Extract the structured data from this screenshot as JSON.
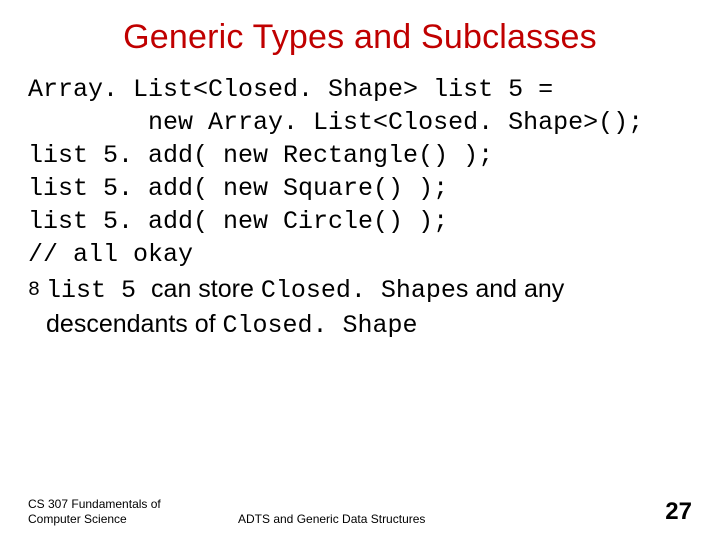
{
  "title": "Generic Types and Subclasses",
  "code": {
    "l1": "Array. List<Closed. Shape> list 5 =",
    "l2": "        new Array. List<Closed. Shape>();",
    "l3": "list 5. add( new Rectangle() );",
    "l4": "list 5. add( new Square() );",
    "l5": "list 5. add( new Circle() );",
    "l6": "// all okay"
  },
  "bullet": {
    "marker": "8",
    "m1": "list 5 ",
    "t1": "can store ",
    "m2": "Closed. Shape",
    "t2": "s and any descendants of ",
    "m3": "Closed. Shape"
  },
  "footer": {
    "left": "CS 307 Fundamentals of Computer Science",
    "center": "ADTS and Generic Data Structures",
    "page": "27"
  }
}
